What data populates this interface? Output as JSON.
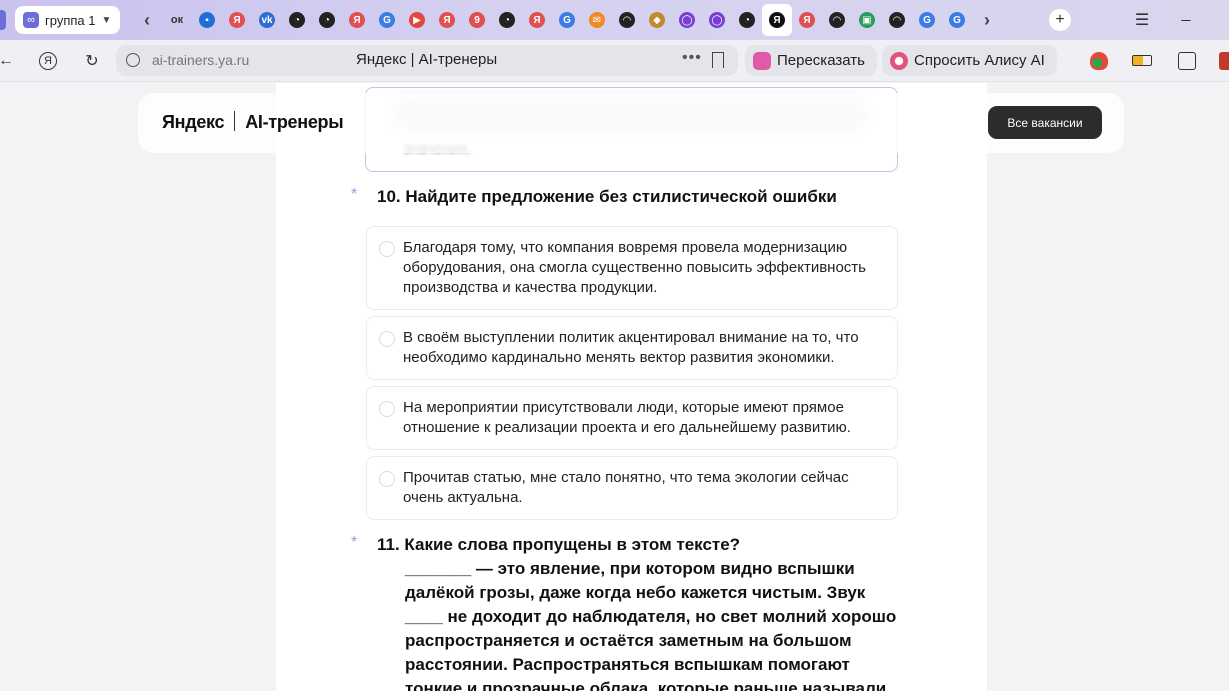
{
  "tabbar": {
    "active_tab_label": "группа 1",
    "active_tab_icon": "∞",
    "tab_icons": [
      {
        "name": "back-tabs-icon",
        "glyph": "‹",
        "color": "#444"
      },
      {
        "name": "ok-tab-icon",
        "glyph": "ок",
        "color": "#333"
      },
      {
        "name": "chat-tab-icon",
        "glyph": "▪",
        "color": "#1f6fd6"
      },
      {
        "name": "yandex-tab-icon",
        "glyph": "Я",
        "color": "#e0504e"
      },
      {
        "name": "vk-tab-icon",
        "glyph": "vk",
        "color": "#2a6fd0"
      },
      {
        "name": "clock-tab-icon",
        "glyph": "◔",
        "color": "#222"
      },
      {
        "name": "clock-tab-icon",
        "glyph": "◔",
        "color": "#222"
      },
      {
        "name": "yandex-tab-icon",
        "glyph": "Я",
        "color": "#e0504e"
      },
      {
        "name": "google-tab-icon",
        "glyph": "G",
        "color": "#3b7de3"
      },
      {
        "name": "video-tab-icon",
        "glyph": "▶",
        "color": "#e2463f"
      },
      {
        "name": "yandex-tab-icon",
        "glyph": "Я",
        "color": "#e0504e"
      },
      {
        "name": "nine-tab-icon",
        "glyph": "9",
        "color": "#e0504e"
      },
      {
        "name": "clock-tab-icon",
        "glyph": "◔",
        "color": "#222"
      },
      {
        "name": "yandex-tab-icon",
        "glyph": "Я",
        "color": "#e0504e"
      },
      {
        "name": "google-tab-icon",
        "glyph": "G",
        "color": "#3b7de3"
      },
      {
        "name": "mail-tab-icon",
        "glyph": "✉",
        "color": "#f08a24"
      },
      {
        "name": "alice-tab-icon",
        "glyph": "◠",
        "color": "#222"
      },
      {
        "name": "gallery-tab-icon",
        "glyph": "◆",
        "color": "#c28a2d"
      },
      {
        "name": "ring-tab-icon",
        "glyph": "◯",
        "color": "#7a3fd0"
      },
      {
        "name": "ring-tab-icon",
        "glyph": "◯",
        "color": "#7a3fd0"
      },
      {
        "name": "clock-tab-icon",
        "glyph": "◔",
        "color": "#222"
      },
      {
        "name": "yandex-selected-tab-icon",
        "glyph": "Я",
        "color": "#111"
      },
      {
        "name": "yandex-tab-icon",
        "glyph": "Я",
        "color": "#e0504e"
      },
      {
        "name": "alice-tab-icon",
        "glyph": "◠",
        "color": "#222"
      },
      {
        "name": "photo-tab-icon",
        "glyph": "▣",
        "color": "#2a9d5c"
      },
      {
        "name": "alice-tab-icon",
        "glyph": "◠",
        "color": "#222"
      },
      {
        "name": "google-tab-icon",
        "glyph": "G",
        "color": "#3b7de3"
      },
      {
        "name": "google-tab-icon",
        "glyph": "G",
        "color": "#3b7de3"
      },
      {
        "name": "forward-tabs-icon",
        "glyph": "›",
        "color": "#444"
      }
    ],
    "new_tab_glyph": "+",
    "menu_glyph": "☰",
    "minimize_glyph": "_"
  },
  "addressbar": {
    "url": "ai-trainers.ya.ru",
    "page_title": "Яндекс | AI-тренеры",
    "retell_label": "Пересказать",
    "ask_alice_label": "Спросить Алису AI"
  },
  "header": {
    "logo_brand": "Яндекс",
    "logo_product": "AI-тренеры",
    "vacancies_button": "Все вакансии"
  },
  "prev_option_tail": "значения.",
  "question10": {
    "star": "*",
    "title": "10. Найдите предложение без стилистической ошибки",
    "options": [
      "Благодаря тому, что компания вовремя провела модернизацию оборудования, она смогла существенно повысить эффективность производства и качества продукции.",
      "В своём выступлении политик акцентировал внимание на то, что необходимо кардинально менять вектор развития экономики.",
      "На мероприятии присутствовали люди, которые имеют прямое отношение к реализации проекта и его дальнейшему развитию.",
      "Прочитав статью, мне стало понятно, что тема экологии сейчас очень актуальна."
    ]
  },
  "question11": {
    "star": "*",
    "title": "11. Какие слова пропущены в этом тексте?",
    "body": "_______ — это явление, при котором видно вспышки далёкой грозы, даже когда небо кажется чистым. Звук ____ не доходит до наблюдателя, но свет молний хорошо распространяется и остаётся заметным на большом расстоянии. Распространяться вспышкам помогают тонкие и прозрачные облака, которые раньше называли «кисейными»."
  }
}
